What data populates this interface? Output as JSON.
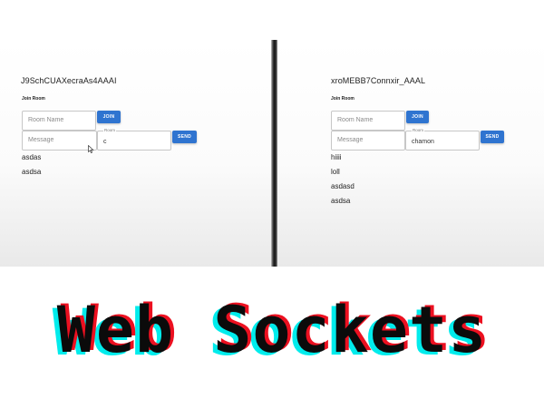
{
  "left_client": {
    "socket_id": "J9SchCUAXecraAs4AAAI",
    "join_heading": "Join Room",
    "room_name_placeholder": "Room Name",
    "join_label": "JOIN",
    "message_placeholder": "Message",
    "room_label": "Room",
    "room_value": "c",
    "send_label": "SEND",
    "messages": [
      "asdas",
      "asdsa"
    ]
  },
  "right_client": {
    "socket_id": "xroMEBB7Connxir_AAAL",
    "join_heading": "Join Room",
    "room_name_placeholder": "Room Name",
    "join_label": "JOIN",
    "message_placeholder": "Message",
    "room_label": "Room",
    "room_value": "chamon",
    "send_label": "SEND",
    "messages": [
      "hiiii",
      "loll",
      "asdasd",
      "asdsa"
    ]
  },
  "banner": {
    "title": "Web Sockets",
    "colors": {
      "shadow_cyan": "#00ecec",
      "shadow_red": "#ec1020",
      "text": "#0b0b0b"
    }
  },
  "theme": {
    "button_color": "#2f74d0"
  }
}
